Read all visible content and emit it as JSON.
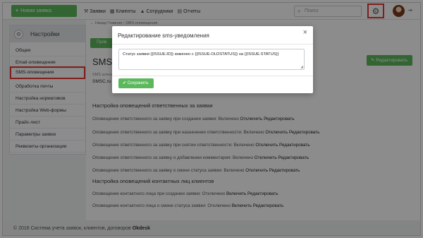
{
  "topbar": {
    "new_button": "Новая заявка",
    "nav": [
      {
        "icon": "wrench-icon",
        "glyph": "⚒",
        "label": "Заявки"
      },
      {
        "icon": "clients-icon",
        "glyph": "▦",
        "label": "Клиенты"
      },
      {
        "icon": "employees-icon",
        "glyph": "▲",
        "label": "Сотрудники"
      },
      {
        "icon": "reports-icon",
        "glyph": "▤",
        "label": "Отчеты"
      }
    ],
    "search_placeholder": "Поиск"
  },
  "sidebar": {
    "title": "Настройки",
    "items": [
      "Общее",
      "Email-оповещения",
      "SMS-оповещения",
      "Обработка почты",
      "Настройка нормативов",
      "Настройка Web-формы",
      "Прайс-лист",
      "Параметры заявок",
      "Реквизиты организации"
    ],
    "active_index": 2
  },
  "main": {
    "breadcrumb": "← Назад   Главная › SMS-оповещения",
    "green_tab": "Пров",
    "page_title": "SMS-о",
    "field_label": "SMS шлюз",
    "field_value": "SMSC.ru",
    "edit_button": "Редактировать",
    "section1_title": "Настройка оповещений ответственных за заявки",
    "section1_rows": [
      {
        "text": "Оповещение ответственного за заявку при создании заявки: Включено ",
        "links": [
          "Отключить",
          "Редактировать"
        ]
      },
      {
        "text": "Оповещение ответственного за заявку при назначении ответственности: Включено ",
        "links": [
          "Отключить",
          "Редактировать"
        ]
      },
      {
        "text": "Оповещение ответственного за заявку при снятии ответственности: Включено ",
        "links": [
          "Отключить",
          "Редактировать"
        ]
      },
      {
        "text": "Оповещение ответственного за заявку о добавлении комментария: Включено ",
        "links": [
          "Отключить",
          "Редактировать"
        ]
      },
      {
        "text": "Оповещение ответственного за заявку о смене статуса заявки: Включено ",
        "links": [
          "Отключить",
          "Редактировать"
        ]
      }
    ],
    "section2_title": "Настройка оповещений контактных лиц клиентов",
    "section2_rows": [
      {
        "text": "Оповещение контактного лица при создании заявки: Отключено ",
        "links": [
          "Включить",
          "Редактировать"
        ]
      },
      {
        "text": "Оповещение контактного лица о смене статуса заявки: Отключено ",
        "links": [
          "Включить",
          "Редактировать"
        ]
      }
    ]
  },
  "footer": {
    "text": "© 2016 Система учета заявок, клиентов, договоров ",
    "brand": "Okdesk"
  },
  "modal": {
    "title": "Редактирование sms-уведомления",
    "template_text": "Статус заявки {{ISSUE.ID}} изменен с {{ISSUE.OLDSTATUS}} на {{ISSUE.STATUS}}",
    "save_button": "Сохранить",
    "close_glyph": "×"
  },
  "colors": {
    "accent_green": "#5cb85c",
    "highlight_red": "#e53935"
  }
}
